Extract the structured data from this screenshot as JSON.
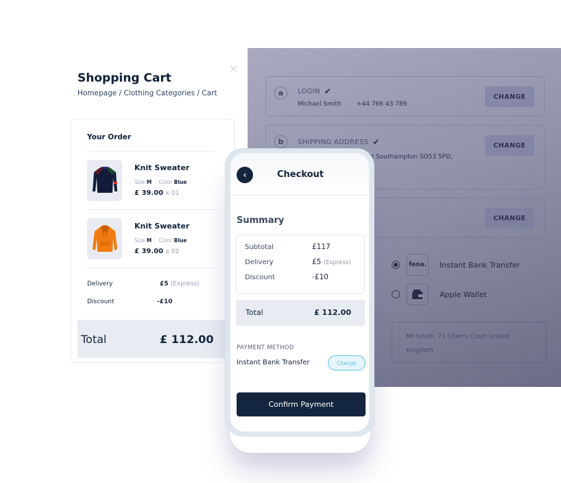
{
  "cart": {
    "title": "Shopping Cart",
    "breadcrumb": "Homepage / Clothing Categories / Cart",
    "close_icon": "×",
    "order_title": "Your Order",
    "items": [
      {
        "name": "Knit Sweater",
        "size_label": "Size",
        "size": "M",
        "color_label": "Color",
        "color": "Blue",
        "price": "£ 39.00",
        "qty": "x 01",
        "image": "navy-sweater"
      },
      {
        "name": "Knit Sweater",
        "size_label": "Size",
        "size": "M",
        "color_label": "Color",
        "color": "Blue",
        "price": "£ 39.00",
        "qty": "x 02",
        "image": "orange-hoodie"
      }
    ],
    "delivery_label": "Delivery",
    "delivery_value": "£5",
    "delivery_note": "(Express)",
    "discount_label": "Discount",
    "discount_value": "-£10",
    "total_label": "Total",
    "total_value": "£ 112.00"
  },
  "checkout_page": {
    "steps": [
      {
        "letter": "a",
        "title": "LOGIN",
        "check": "✔",
        "name": "Michael Smith",
        "phone": "+44 766 43 789",
        "button": "CHANGE"
      },
      {
        "letter": "b",
        "title": "SHIPPING ADDRESS",
        "check": "✔",
        "address_partial": "rt Southampton SO53 5PD,",
        "button": "CHANGE"
      },
      {
        "button": "CHANGE"
      }
    ],
    "payment_options": [
      {
        "logo": "fena.",
        "label": "Instant Bank Transfer",
        "selected": true
      },
      {
        "logo": "wallet-icon",
        "label": "Apple Wallet",
        "selected": false
      }
    ],
    "address_line1": "Mr Smith, 71 Cherry Court United",
    "address_line2": "Kingdom"
  },
  "phone": {
    "back_icon": "‹",
    "title": "Checkout",
    "summary_title": "Summary",
    "rows": [
      {
        "label": "Subtotal",
        "value": "£117",
        "note": ""
      },
      {
        "label": "Delivery",
        "value": "£5",
        "note": "(Express)"
      },
      {
        "label": "Discount",
        "value": "-£10",
        "note": ""
      }
    ],
    "total_label": "Total",
    "total_value": "£ 112.00",
    "payment_method_label": "PAYMENT METHOD",
    "payment_method_value": "Instant Bank Transfer",
    "change_label": "Change",
    "confirm_label": "Confirm Payment"
  },
  "colors": {
    "navy": "#14243b",
    "accent_blue": "#5bbfe8",
    "overlay": "#9192aa"
  }
}
